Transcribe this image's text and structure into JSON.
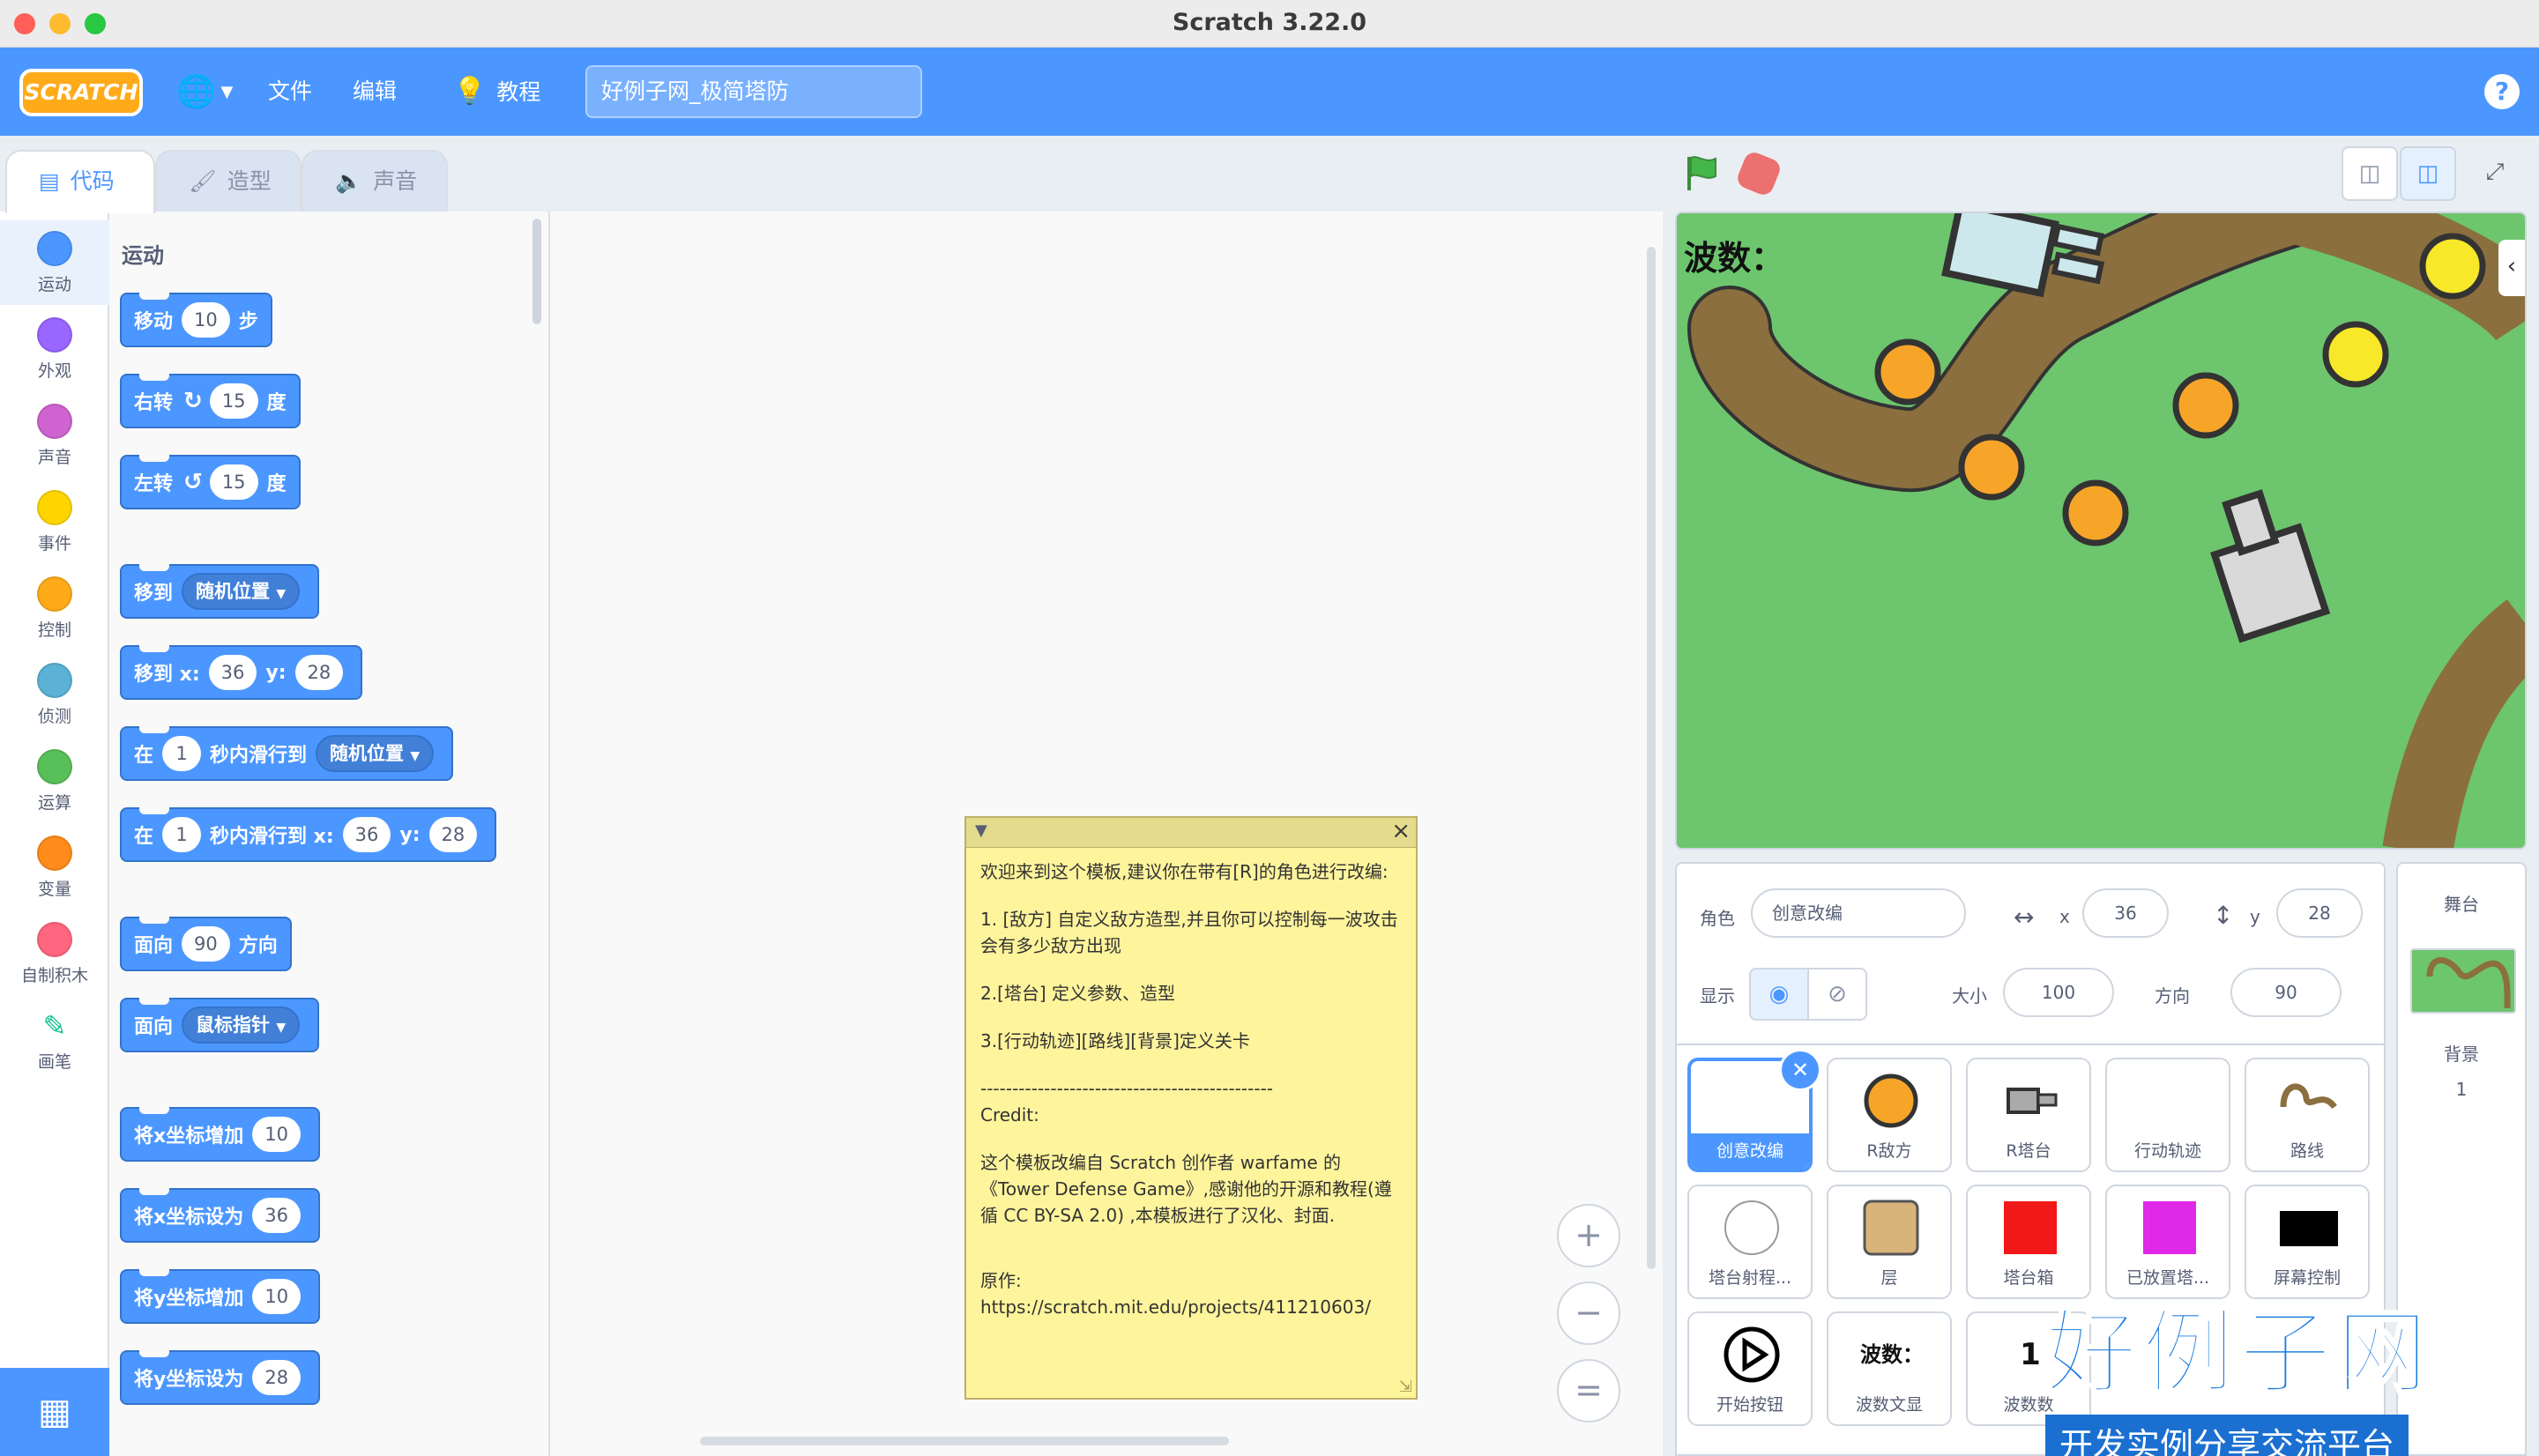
{
  "window": {
    "title": "Scratch 3.22.0"
  },
  "menubar": {
    "logo": "SCRATCH",
    "file": "文件",
    "edit": "编辑",
    "tutorials": "教程",
    "project_title": "好例子网_极简塔防",
    "help": "?"
  },
  "tabs": {
    "code": "代码",
    "costumes": "造型",
    "sounds": "声音"
  },
  "categories": [
    {
      "label": "运动",
      "color": "#4c97ff"
    },
    {
      "label": "外观",
      "color": "#9966ff"
    },
    {
      "label": "声音",
      "color": "#cf63cf"
    },
    {
      "label": "事件",
      "color": "#ffd500"
    },
    {
      "label": "控制",
      "color": "#ffab19"
    },
    {
      "label": "侦测",
      "color": "#5cb1d6"
    },
    {
      "label": "运算",
      "color": "#59c059"
    },
    {
      "label": "变量",
      "color": "#ff8c1a"
    },
    {
      "label": "自制积木",
      "color": "#ff6680"
    },
    {
      "label": "画笔",
      "color": "#0fbd8c"
    }
  ],
  "palette": {
    "heading": "运动",
    "blocks": {
      "move": {
        "a": "移动",
        "v": "10",
        "b": "步"
      },
      "turn_right": {
        "a": "右转",
        "v": "15",
        "b": "度"
      },
      "turn_left": {
        "a": "左转",
        "v": "15",
        "b": "度"
      },
      "goto": {
        "a": "移到",
        "dd": "随机位置"
      },
      "goto_xy": {
        "a": "移到 x:",
        "x": "36",
        "b": "y:",
        "y": "28"
      },
      "glide": {
        "a": "在",
        "v": "1",
        "b": "秒内滑行到",
        "dd": "随机位置"
      },
      "glide_xy": {
        "a": "在",
        "v": "1",
        "b": "秒内滑行到 x:",
        "x": "36",
        "c": "y:",
        "y": "28"
      },
      "point_dir": {
        "a": "面向",
        "v": "90",
        "b": "方向"
      },
      "point_towards": {
        "a": "面向",
        "dd": "鼠标指针"
      },
      "change_x": {
        "a": "将x坐标增加",
        "v": "10"
      },
      "set_x": {
        "a": "将x坐标设为",
        "v": "36"
      },
      "change_y": {
        "a": "将y坐标增加",
        "v": "10"
      },
      "set_y": {
        "a": "将y坐标设为",
        "v": "28"
      }
    }
  },
  "comment": {
    "p1": "欢迎来到这个模板,建议你在带有[R]的角色进行改编:",
    "p2": "1. [敌方] 自定义敌方造型,并且你可以控制每一波攻击会有多少敌方出现",
    "p3": "2.[塔台] 定义参数、造型",
    "p4": "3.[行动轨迹][路线][背景]定义关卡",
    "divider": "----------------------------------------------",
    "credit": "Credit:",
    "p5": "这个模板改编自 Scratch 创作者 warfame 的《Tower Defense Game》,感谢他的开源和教程(遵循 CC BY-SA 2.0) ,本模板进行了汉化、封面.",
    "original_label": "原作:",
    "original_url": "https://scratch.mit.edu/projects/411210603/"
  },
  "zoom": {
    "in": "+",
    "out": "−",
    "reset": "="
  },
  "stage": {
    "label": "波数："
  },
  "sprite_info": {
    "sprite_label": "角色",
    "sprite_name": "创意改编",
    "x_label": "x",
    "x": "36",
    "y_label": "y",
    "y": "28",
    "show_label": "显示",
    "size_label": "大小",
    "size": "100",
    "direction_label": "方向",
    "direction": "90"
  },
  "sprites": [
    {
      "name": "创意改编",
      "thumb": "blank"
    },
    {
      "name": "R敌方",
      "thumb": "orange-circle"
    },
    {
      "name": "R塔台",
      "thumb": "turret"
    },
    {
      "name": "行动轨迹",
      "thumb": "blank"
    },
    {
      "name": "路线",
      "thumb": "path"
    },
    {
      "name": "塔台射程...",
      "thumb": "white-circle"
    },
    {
      "name": "层",
      "thumb": "tan-square"
    },
    {
      "name": "塔台箱",
      "thumb": "red-square"
    },
    {
      "name": "已放置塔...",
      "thumb": "magenta-square"
    },
    {
      "name": "屏幕控制",
      "thumb": "black-rect"
    },
    {
      "name": "开始按钮",
      "thumb": "play-button"
    },
    {
      "name": "波数文显",
      "thumb": "text-wave",
      "thumb_text": "波数："
    },
    {
      "name": "波数数",
      "thumb": "text-num",
      "thumb_text": "1"
    }
  ],
  "stage_pane": {
    "heading": "舞台",
    "backdrop_label": "背景",
    "backdrop_count": "1"
  },
  "watermark": {
    "main": "好例子网",
    "sub": "开发实例分享交流平台"
  }
}
